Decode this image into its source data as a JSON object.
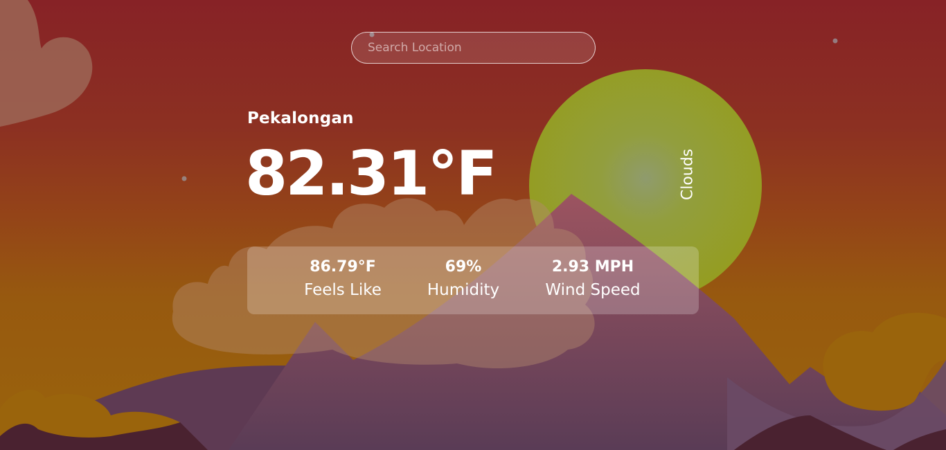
{
  "search": {
    "placeholder": "Search Location"
  },
  "weather": {
    "city": "Pekalongan",
    "temperature": "82.31°F",
    "description": "Clouds"
  },
  "stats": [
    {
      "value": "86.79°F",
      "label": "Feels Like"
    },
    {
      "value": "69%",
      "label": "Humidity"
    },
    {
      "value": "2.93 MPH",
      "label": "Wind Speed"
    }
  ],
  "colors": {
    "sky_top": "#872226",
    "sky_bottom": "#9a640c",
    "sun": "#95a021",
    "cloud": "#a47b6e",
    "mountain_light": "#8e5a6e",
    "mountain_dark": "#4a2230"
  }
}
